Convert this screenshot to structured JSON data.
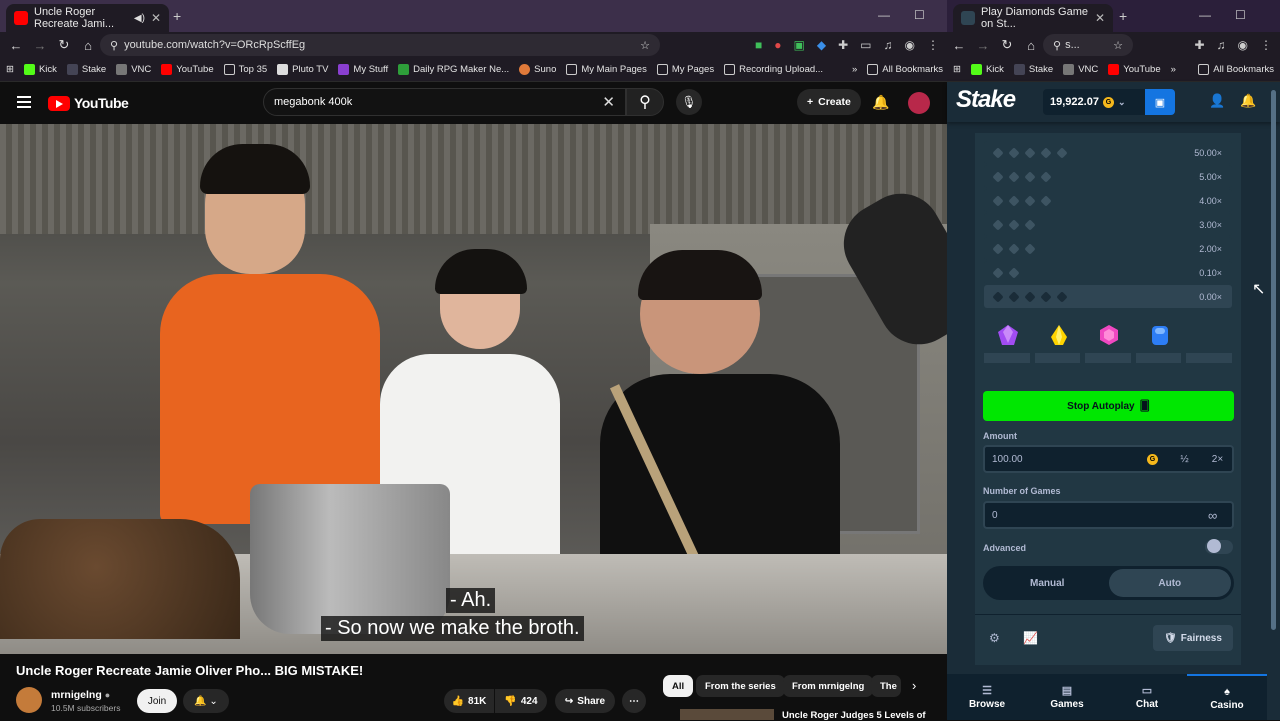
{
  "left_browser": {
    "tab_title": "Uncle Roger Recreate Jami...",
    "url": "youtube.com/watch?v=ORcRpScffEg",
    "bookmarks": [
      "Kick",
      "Stake",
      "VNC",
      "YouTube",
      "Top 35",
      "Pluto TV",
      "My Stuff",
      "Daily RPG Maker Ne...",
      "Suno",
      "My Main Pages",
      "My Pages",
      "Recording Upload..."
    ],
    "bookmarks_overflow": "»",
    "all_bookmarks": "All Bookmarks"
  },
  "youtube": {
    "logo": "YouTube",
    "search_value": "megabonk 400k",
    "create_label": "Create",
    "subtitles": [
      "- Ah.",
      "- So now we make the broth."
    ],
    "video_title": "Uncle Roger Recreate Jamie Oliver Pho... BIG MISTAKE!",
    "channel_name": "mrnigelng",
    "channel_subs": "10.5M subscribers",
    "join_label": "Join",
    "likes": "81K",
    "dislikes": "424",
    "share_label": "Share",
    "more_label": "⋯",
    "chips": [
      "All",
      "From the series",
      "From mrnigelng",
      "The"
    ],
    "next_video_title": "Uncle Roger Judges 5 Levels of"
  },
  "right_browser": {
    "tab_title": "Play Diamonds Game on St...",
    "url_short": "s...",
    "bookmarks": [
      "Kick",
      "Stake",
      "VNC",
      "YouTube"
    ],
    "bookmarks_overflow": "»",
    "all_bookmarks": "All Bookmarks"
  },
  "stake": {
    "logo": "Stake",
    "balance": "19,922.07",
    "currency_symbol": "G",
    "paytable": [
      "50.00×",
      "5.00×",
      "4.00×",
      "3.00×",
      "2.00×",
      "0.10×",
      "0.00×"
    ],
    "stop_autoplay_label": "Stop Autoplay",
    "amount_label": "Amount",
    "amount_value": "100.00",
    "half_label": "½",
    "double_label": "2×",
    "games_label": "Number of Games",
    "games_value": "0",
    "infinity": "∞",
    "advanced_label": "Advanced",
    "mode_manual": "Manual",
    "mode_auto": "Auto",
    "fairness_label": "Fairness",
    "gems": [
      "purple",
      "yellow",
      "pink",
      "blue"
    ],
    "bottom_nav": [
      "Browse",
      "Games",
      "Chat",
      "Casino"
    ],
    "colors": {
      "accent": "#00e701",
      "bg": "#1a2c38",
      "panel": "#213743",
      "input": "#0f212e"
    }
  }
}
